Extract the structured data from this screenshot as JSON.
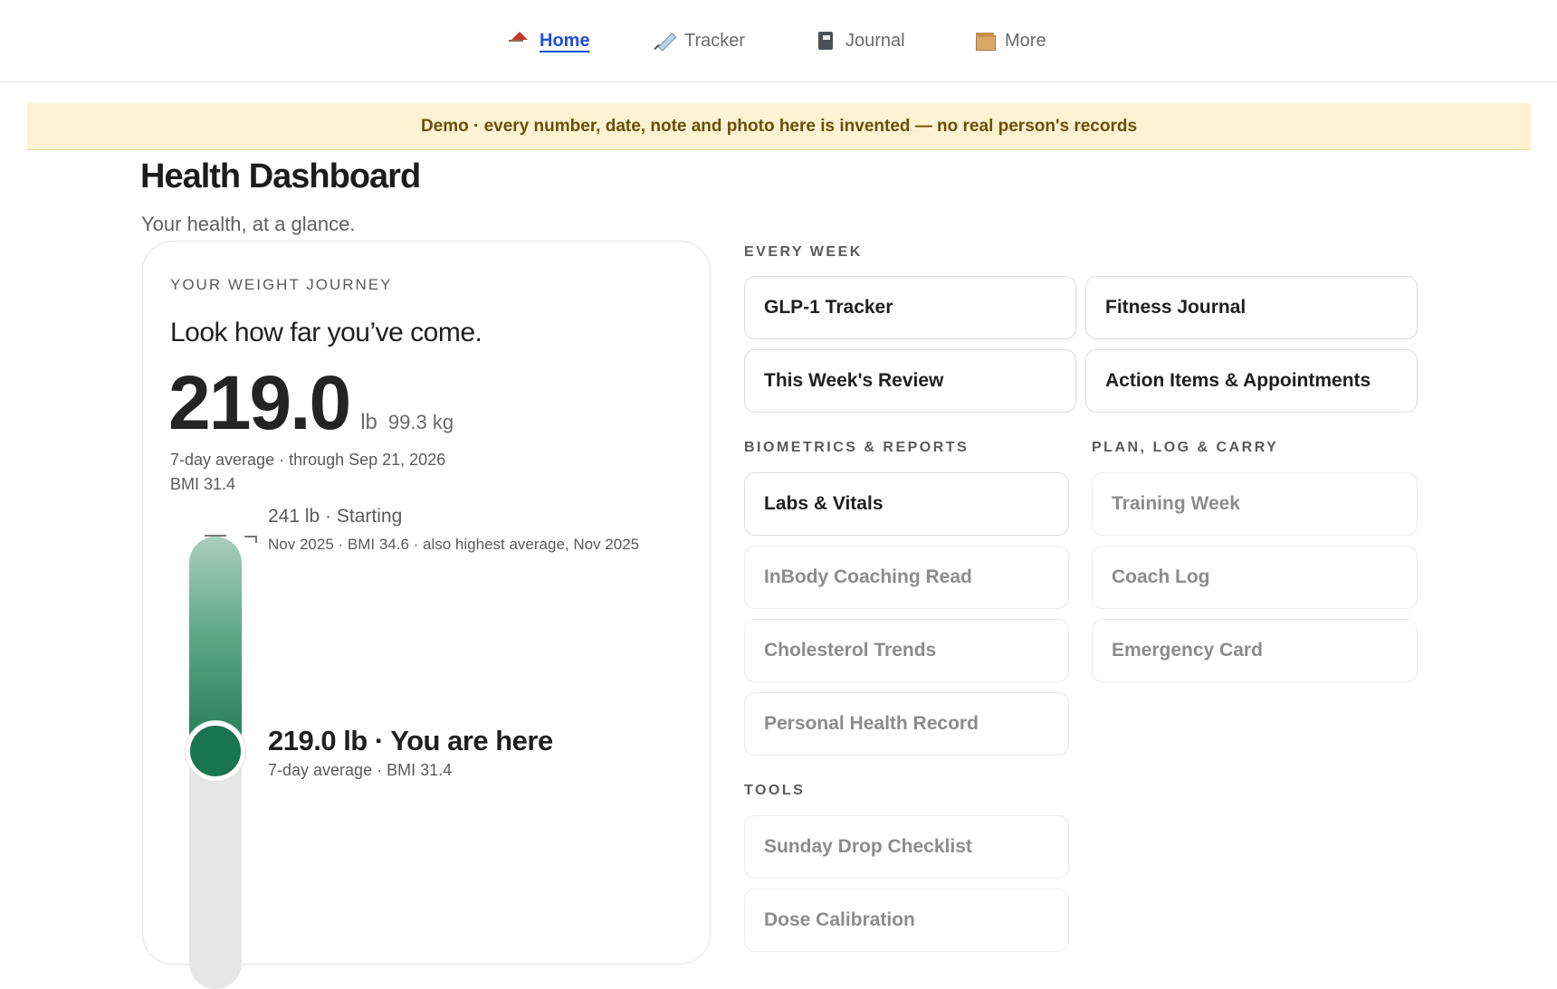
{
  "nav": {
    "items": [
      {
        "label": "Home",
        "icon": "house-icon",
        "active": true
      },
      {
        "label": "Tracker",
        "icon": "syringe-icon",
        "active": false
      },
      {
        "label": "Journal",
        "icon": "notebook-icon",
        "active": false
      },
      {
        "label": "More",
        "icon": "box-icon",
        "active": false
      }
    ]
  },
  "banner": {
    "text": "Demo · every number, date, note and photo here is invented — no real person's records"
  },
  "header": {
    "title": "Health Dashboard",
    "subtitle": "Your health, at a glance."
  },
  "weight": {
    "eyebrow": "YOUR WEIGHT JOURNEY",
    "headline": "Look how far you’ve come.",
    "value": "219.0",
    "unit": "lb",
    "kg": "99.3 kg",
    "meta_line1": "7-day average · through Sep 21, 2026",
    "meta_line2": "BMI 31.4",
    "start_label": "241 lb · Starting",
    "start_sub": "Nov 2025 · BMI 34.6 · also highest average, Nov 2025",
    "current_label": "219.0 lb · You are here",
    "current_sub": "7-day average · BMI 31.4",
    "start_weight": 241,
    "current_weight": 219.0
  },
  "sections": {
    "every_week": {
      "label": "EVERY WEEK",
      "tiles": [
        "GLP-1 Tracker",
        "Fitness Journal",
        "This Week's Review",
        "Action Items & Appointments"
      ]
    },
    "biometrics": {
      "label": "BIOMETRICS & REPORTS",
      "tiles": [
        "Labs & Vitals",
        "InBody Coaching Read",
        "Cholesterol Trends",
        "Personal Health Record"
      ]
    },
    "plan": {
      "label": "PLAN, LOG & CARRY",
      "tiles": [
        "Training Week",
        "Coach Log",
        "Emergency Card"
      ]
    },
    "tools": {
      "label": "TOOLS",
      "tiles": [
        "Sunday Drop Checklist",
        "Dose Calibration"
      ]
    }
  },
  "colors": {
    "accent": "#1f4ed8",
    "banner_bg": "#fdf3d3",
    "banner_text": "#6b4e06",
    "progress_green": "#187451"
  }
}
